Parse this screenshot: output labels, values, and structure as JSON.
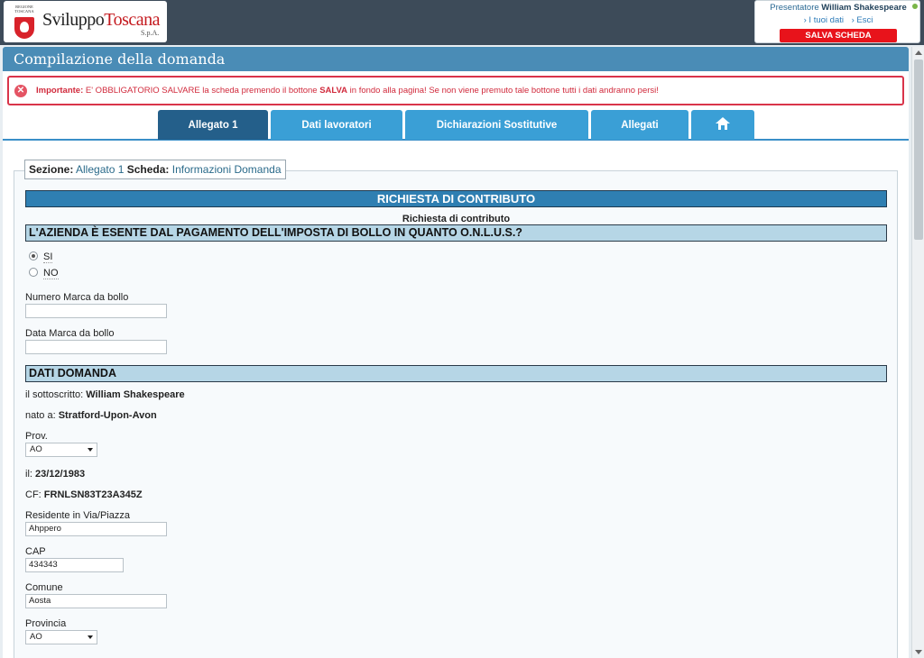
{
  "header": {
    "logo_region": "REGIONE TOSCANA",
    "logo_main": "Sviluppo",
    "logo_accent": "Toscana",
    "logo_spa": "S.p.A.",
    "presenter_prefix": "Presentatore",
    "presenter_name": "William Shakespeare",
    "link_my_data": "› I tuoi dati",
    "link_exit": "› Esci",
    "save_button": "SALVA SCHEDA"
  },
  "page_title": "Compilazione della domanda",
  "alert": {
    "label": "Importante:",
    "text_1": "E' OBBLIGATORIO SALVARE",
    "text_2": "la scheda premendo il bottone",
    "text_3": "SALVA",
    "text_4": "in fondo alla pagina! Se non viene premuto tale bottone tutti i dati andranno persi!"
  },
  "tabs": [
    {
      "label": "Allegato 1"
    },
    {
      "label": "Dati lavoratori"
    },
    {
      "label": "Dichiarazioni Sostitutive"
    },
    {
      "label": "Allegati"
    }
  ],
  "section": {
    "sezione_label": "Sezione:",
    "sezione_value": "Allegato 1",
    "scheda_label": "Scheda:",
    "scheda_value": "Informazioni Domanda"
  },
  "form": {
    "banner_main": "RICHIESTA DI CONTRIBUTO",
    "subcaption": "Richiesta di contributo",
    "question_onlus": "L'AZIENDA È ESENTE DAL PAGAMENTO DELL'IMPOSTA DI BOLLO IN QUANTO O.N.L.U.S.?",
    "radio_yes": "SI",
    "radio_no": "NO",
    "marca_label": "Numero Marca da bollo",
    "marca_value": "",
    "data_marca_label": "Data Marca da bollo",
    "data_marca_value": "",
    "banner_dati": "DATI DOMANDA",
    "sottoscritto_label": "il sottoscritto:",
    "sottoscritto_value": "William Shakespeare",
    "nato_label": "nato a:",
    "nato_value": "Stratford-Upon-Avon",
    "prov_label": "Prov.",
    "prov_value": "AO",
    "il_label": "il:",
    "il_value": "23/12/1983",
    "cf_label": "CF:",
    "cf_value": "FRNLSN83T23A345Z",
    "residente_label": "Residente in Via/Piazza",
    "residente_value": "Ahppero",
    "cap_label": "CAP",
    "cap_value": "434343",
    "comune_label": "Comune",
    "comune_value": "Aosta",
    "provincia_label": "Provincia",
    "provincia_value": "AO"
  }
}
